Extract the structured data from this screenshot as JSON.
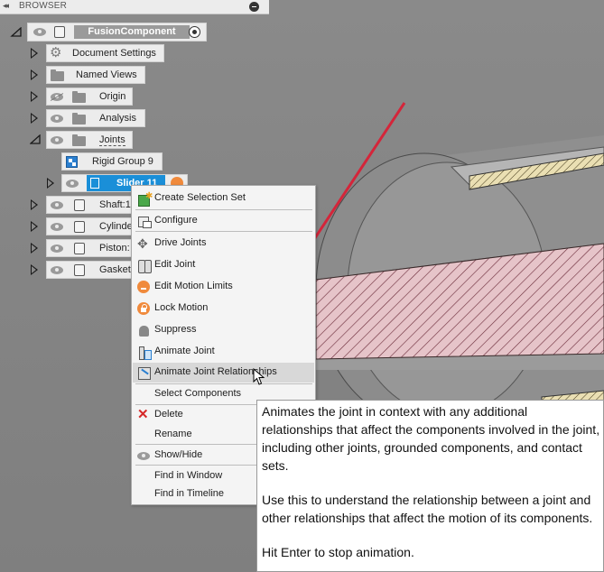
{
  "browser": {
    "title": "BROWSER",
    "collapse_glyph": "◂◂"
  },
  "tree": {
    "root": "FusionComponent",
    "items": [
      {
        "label": "Document Settings"
      },
      {
        "label": "Named Views"
      },
      {
        "label": "Origin"
      },
      {
        "label": "Analysis"
      },
      {
        "label": "Joints"
      },
      {
        "label": "Rigid Group 9"
      },
      {
        "label": "Slider 11"
      },
      {
        "label": "Shaft:1"
      },
      {
        "label": "Cylinde"
      },
      {
        "label": "Piston:"
      },
      {
        "label": "Gasket"
      }
    ]
  },
  "context_menu": {
    "items": [
      {
        "label": "Create Selection Set",
        "icon": "selection-set-icon"
      },
      {
        "label": "Configure",
        "icon": "configure-icon"
      },
      {
        "label": "Drive Joints",
        "icon": "drive-joints-icon"
      },
      {
        "label": "Edit Joint",
        "icon": "edit-joint-icon"
      },
      {
        "label": "Edit Motion Limits",
        "icon": "motion-limits-icon"
      },
      {
        "label": "Lock Motion",
        "icon": "lock-icon"
      },
      {
        "label": "Suppress",
        "icon": "suppress-icon"
      },
      {
        "label": "Animate Joint",
        "icon": "animate-joint-icon"
      },
      {
        "label": "Animate Joint Relationships",
        "icon": "animate-relationships-icon"
      },
      {
        "label": "Select Components",
        "icon": ""
      },
      {
        "label": "Delete",
        "icon": "delete-icon"
      },
      {
        "label": "Rename",
        "icon": ""
      },
      {
        "label": "Show/Hide",
        "icon": "eye-icon"
      },
      {
        "label": "Find in Window",
        "icon": ""
      },
      {
        "label": "Find in Timeline",
        "icon": ""
      }
    ],
    "highlighted": "Animate Joint Relationships"
  },
  "tooltip": {
    "p1": "Animates the joint in context with any additional relationships that affect the components involved in the joint, including other joints, grounded components, and contact sets.",
    "p2": "Use this to understand the relationship between a joint and other relationships that affect the motion of its components.",
    "p3": "Hit Enter to stop animation."
  },
  "colors": {
    "selection_blue": "#1a8fd8",
    "arrow_red": "#d4253a",
    "viewport_gray": "#858585",
    "piston_pink": "#e8c8cc",
    "gasket_tan": "#e8dcae"
  }
}
